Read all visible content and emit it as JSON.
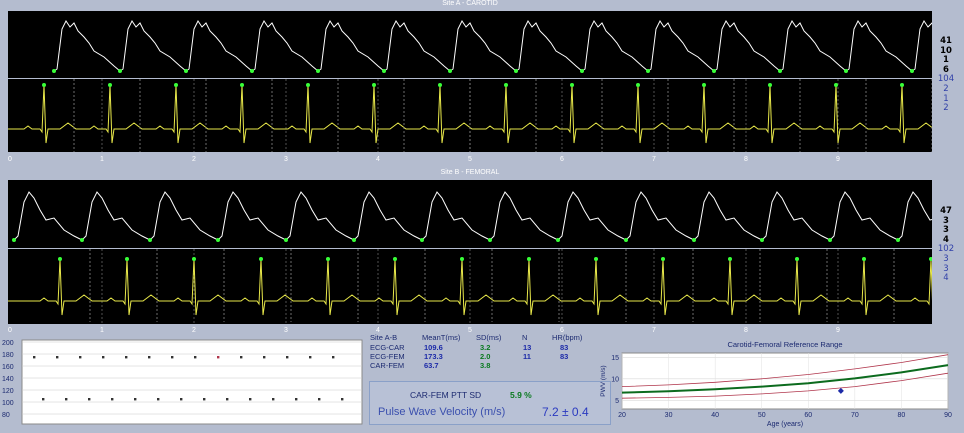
{
  "site_a": {
    "title": "Site A - CAROTID",
    "values": [
      "41",
      "10",
      "1",
      "6"
    ],
    "values_blue": [
      "104",
      "2",
      "1",
      "2"
    ]
  },
  "site_b": {
    "title": "Site B - FEMORAL",
    "values": [
      "47",
      "3",
      "3",
      "4"
    ],
    "values_blue": [
      "102",
      "3",
      "3",
      "4"
    ]
  },
  "time_axis": [
    "0",
    "1",
    "2",
    "3",
    "4",
    "5",
    "6",
    "7",
    "8",
    "9"
  ],
  "ptt_plot": {
    "y_ticks": [
      "200",
      "180",
      "160",
      "140",
      "120",
      "100",
      "80"
    ]
  },
  "stats": {
    "headers": [
      "Site A-B",
      "MeanT(ms)",
      "SD(ms)",
      "N",
      "HR(bpm)"
    ],
    "rows": [
      {
        "site": "ECG-CAR",
        "mean": "109.6",
        "sd": "3.2",
        "n": "13",
        "hr": "83"
      },
      {
        "site": "ECG-FEM",
        "mean": "173.3",
        "sd": "2.0",
        "n": "11",
        "hr": "83"
      },
      {
        "site": "CAR-FEM",
        "mean": "63.7",
        "sd": "3.8",
        "n": "",
        "hr": ""
      }
    ],
    "ptt_sd_label": "CAR-FEM PTT SD",
    "ptt_sd_value": "5.9 %",
    "pwv_label": "Pulse Wave Velocity (m/s)",
    "pwv_value": "7.2 ± 0.4"
  },
  "colors": {
    "pulse": "#ffffff",
    "ecg": "#e8e84a",
    "marker": "#38ff38",
    "background": "#b4bccf",
    "trend": "#0c6b1e",
    "bounds": "#b0354b",
    "patient": "#1c2aa8"
  },
  "chart_data": {
    "type": "line",
    "title": "Carotid-Femoral Reference Range",
    "xlabel": "Age (years)",
    "ylabel": "PWV (m/s)",
    "xlim": [
      20,
      90
    ],
    "ylim": [
      3,
      16
    ],
    "x_ticks": [
      "20",
      "30",
      "40",
      "50",
      "60",
      "70",
      "80",
      "90"
    ],
    "y_ticks": [
      "5",
      "10",
      "15"
    ],
    "x": [
      20,
      30,
      40,
      50,
      60,
      70,
      80,
      90
    ],
    "series": [
      {
        "values": [
          6.8,
          7.1,
          7.6,
          8.2,
          9.0,
          10.1,
          11.5,
          13.2
        ]
      },
      {
        "values": [
          5.5,
          5.7,
          6.0,
          6.5,
          7.2,
          8.2,
          9.6,
          11.3
        ]
      },
      {
        "values": [
          8.2,
          8.6,
          9.2,
          10.0,
          11.0,
          12.3,
          13.8,
          15.6
        ]
      }
    ],
    "patient": {
      "age": 67,
      "pwv": 7.2
    }
  }
}
